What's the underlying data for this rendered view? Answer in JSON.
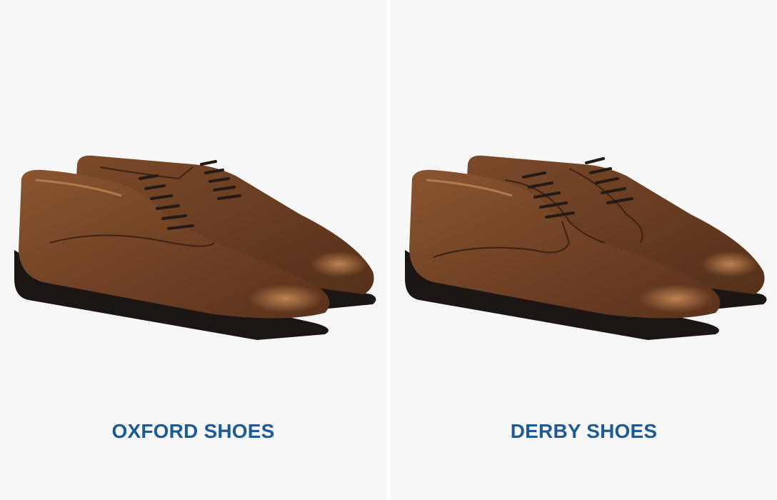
{
  "colors": {
    "background": "#f7f7f7",
    "divider": "#ffffff",
    "label": "#1e5b94",
    "leather": "#7a4a2a",
    "sole": "#1b1614",
    "lace": "#231915"
  },
  "panels": [
    {
      "label": "OXFORD SHOES",
      "shoe_style": "closed-lacing"
    },
    {
      "label": "DERBY SHOES",
      "shoe_style": "open-lacing"
    }
  ]
}
